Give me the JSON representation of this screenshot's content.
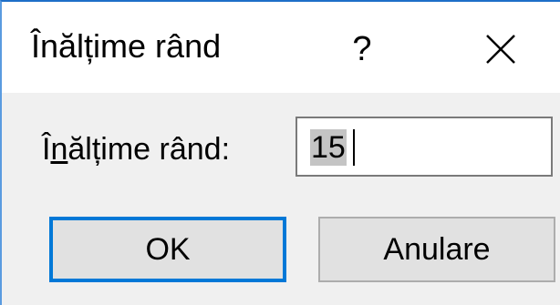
{
  "dialog": {
    "title": "Înălțime rând",
    "help_label": "?",
    "close_icon": "close-icon",
    "field": {
      "label_prefix": "Î",
      "label_mnemonic": "n",
      "label_suffix": "ălțime rând:",
      "value": "15"
    },
    "buttons": {
      "ok_label": "OK",
      "cancel_label": "Anulare"
    }
  },
  "colors": {
    "accent": "#0078d7",
    "button_bg": "#e1e1e1",
    "dialog_bg": "#f0f0f0"
  }
}
